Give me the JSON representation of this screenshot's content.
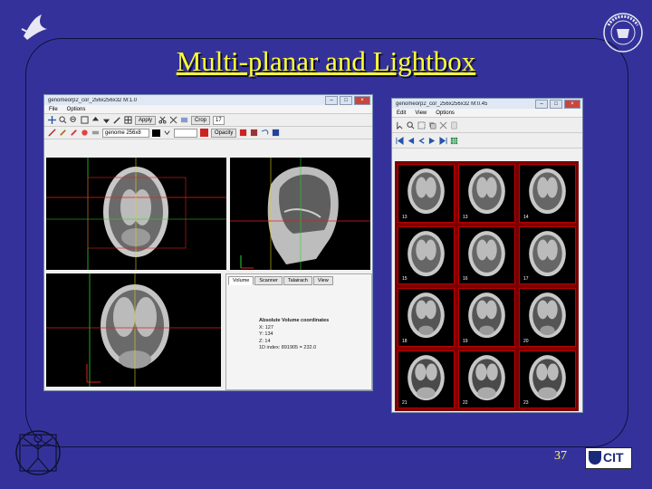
{
  "slide": {
    "title": "Multi-planar and Lightbox",
    "page_number": "37",
    "footer_logo_text": "CIT"
  },
  "multiplanar": {
    "window_title": "genomeorp2_cor_256x256x32 M:1.0",
    "menu": [
      "File",
      "Options"
    ],
    "toolbar": {
      "apply_label": "Apply",
      "crop_label": "Crop",
      "image_field": "genome 256x8",
      "number_field": "17",
      "opacity_label": "Opacity"
    },
    "tabs": [
      "Volume",
      "Scanner",
      "Talairach",
      "View"
    ],
    "coords": {
      "heading": "Absolute Volume coordinates",
      "x": "X: 127",
      "y": "Y: 134",
      "z": "Z: 14",
      "index": "1D index: 891905 = 232.0"
    }
  },
  "lightbox": {
    "window_title": "genomeorp2_cor_256x256x32 M:0.45",
    "menu": [
      "Edit",
      "View",
      "Options"
    ],
    "slice_numbers": [
      "13",
      "13",
      "14",
      "15",
      "16",
      "17",
      "18",
      "19",
      "20",
      "21",
      "22",
      "23"
    ]
  },
  "colors": {
    "background": "#34329a",
    "title": "#ffff33",
    "crosshair_green": "#2fd42f",
    "crosshair_red": "#e02020",
    "lightbox_border": "#c00000"
  }
}
